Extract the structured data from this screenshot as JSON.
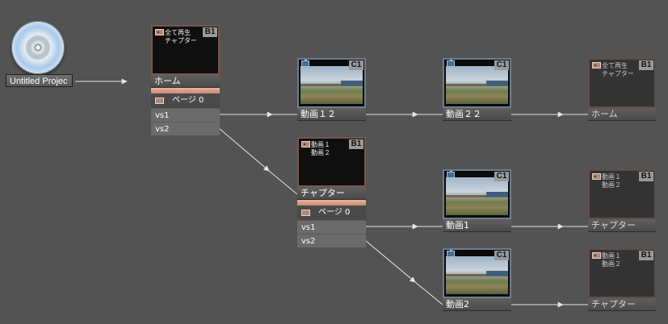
{
  "project": {
    "label": "Untitled Projec",
    "icon": "disc-icon"
  },
  "badges": {
    "b1": "B1",
    "c1": "C1"
  },
  "home_menu": {
    "label": "ホーム",
    "text": "全て再生\nチャプター",
    "page_row": "ページ 0",
    "vs": [
      "vs1",
      "vs2"
    ]
  },
  "chapter_menu": {
    "label": "チャプター",
    "text": "動画１\n動画２",
    "page_row": "ページ 0",
    "vs": [
      "vs1",
      "vs2"
    ]
  },
  "videos": {
    "v12": "動画１２",
    "v22": "動画２２",
    "v1": "動画1",
    "v2": "動画2"
  },
  "targets": {
    "home": {
      "label": "ホーム",
      "text": "全て再生\nチャプター"
    },
    "chapter_a": {
      "label": "チャプター",
      "text": "動画１\n動画２"
    },
    "chapter_b": {
      "label": "チャプター",
      "text": "動画１\n動画２"
    }
  },
  "colors": {
    "background": "#535353",
    "menu_border": "#7b5646",
    "accent": "#d99c84",
    "video_border": "#6c7f92",
    "connector": "#e6e6e6"
  }
}
